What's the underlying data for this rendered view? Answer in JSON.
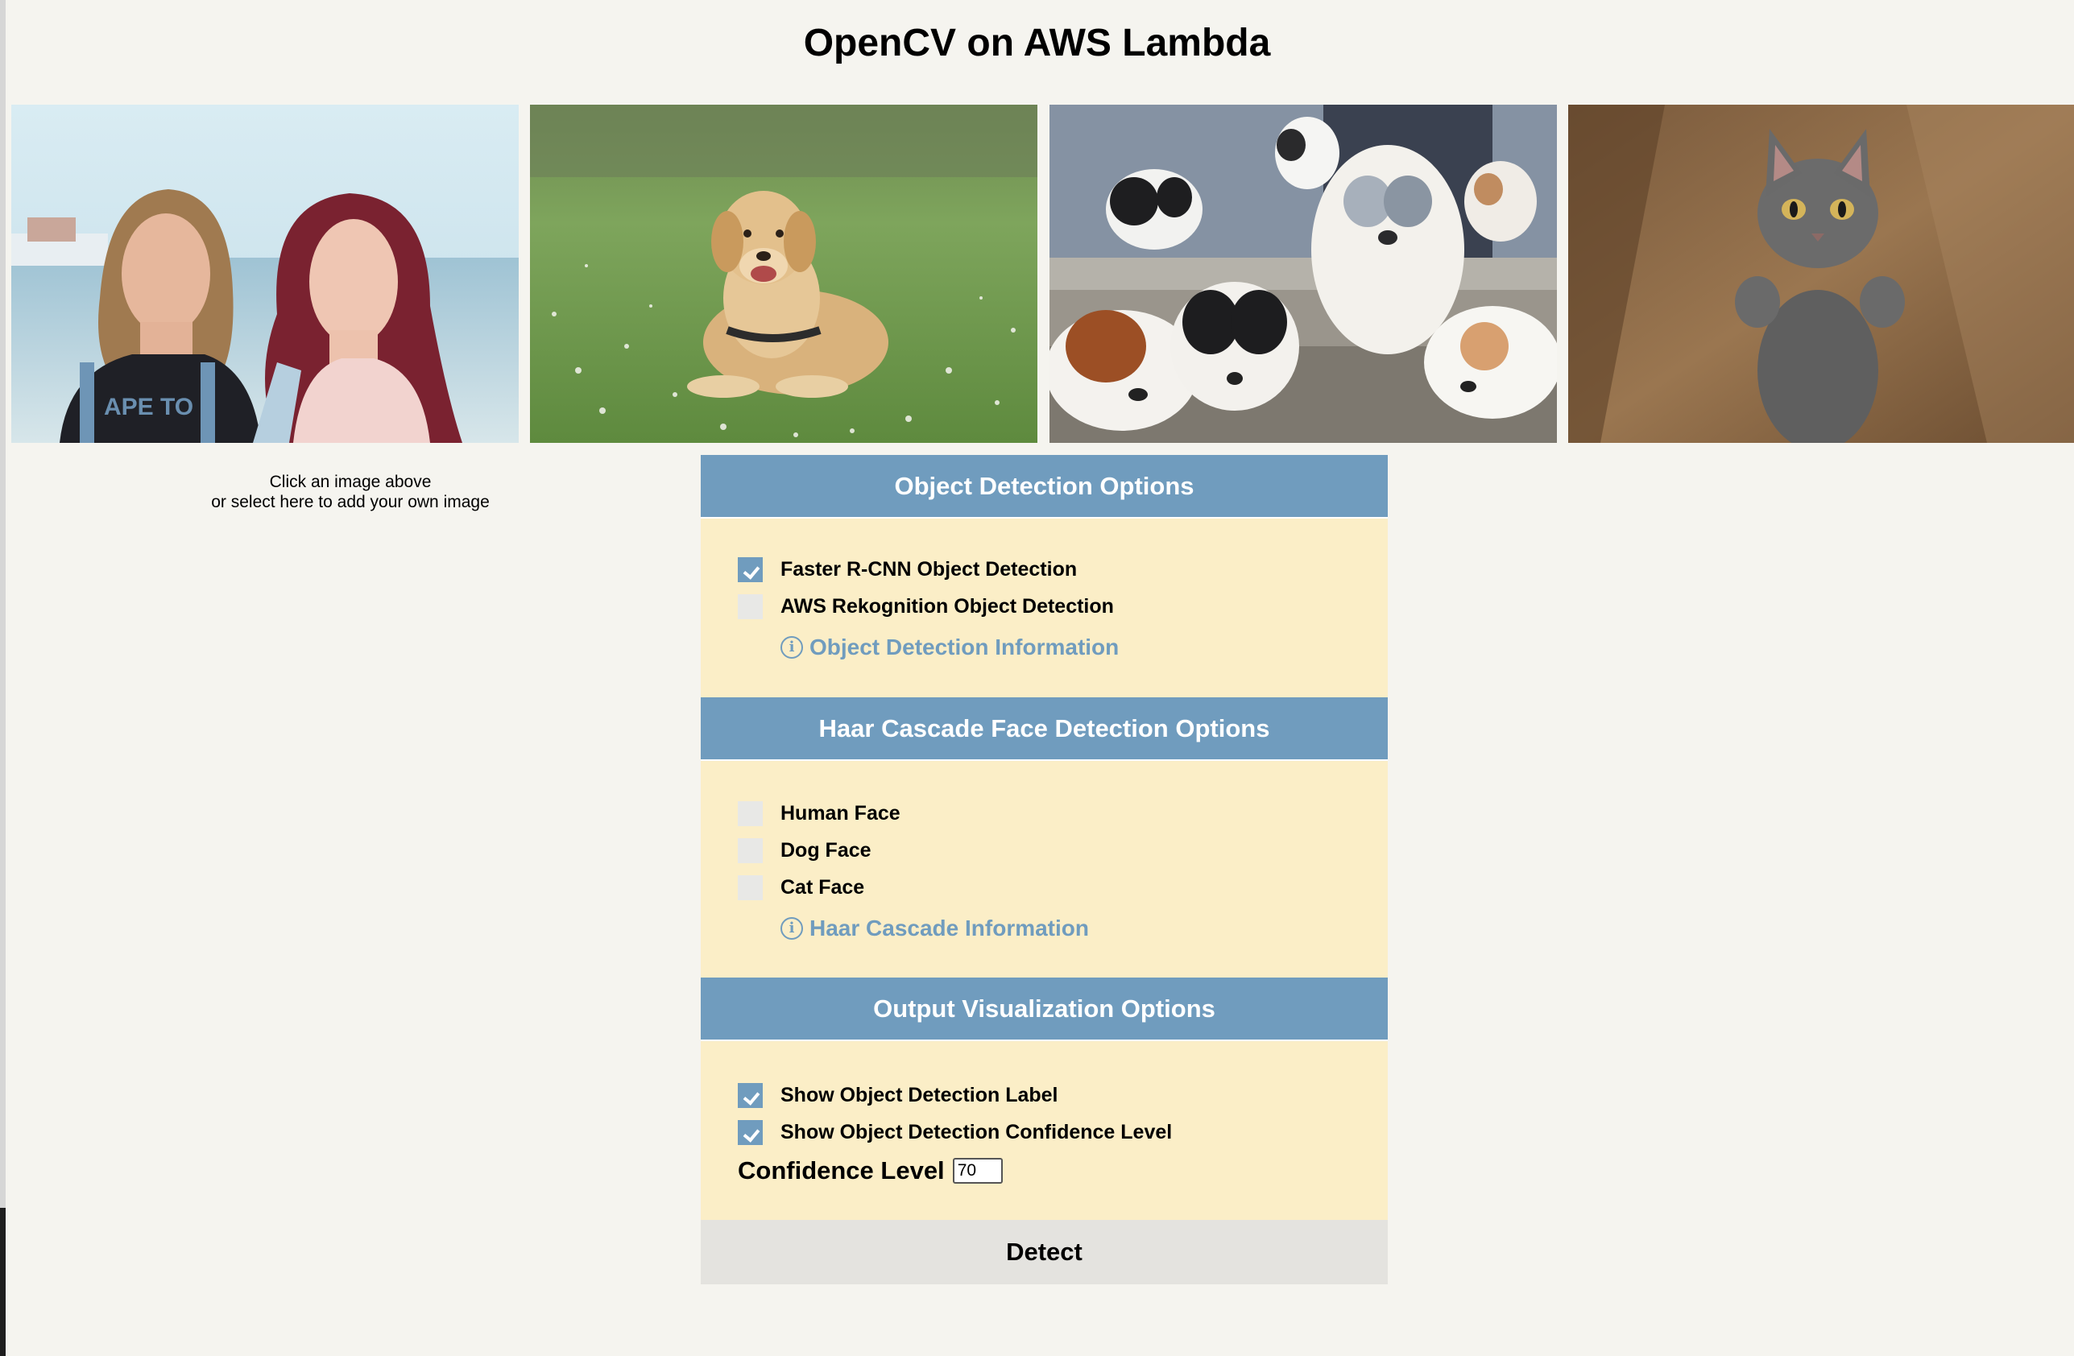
{
  "page": {
    "title": "OpenCV on AWS Lambda"
  },
  "gallery": {
    "images": [
      {
        "name": "two women at the beach",
        "shirt_text": "APE TO"
      },
      {
        "name": "golden retriever in grass"
      },
      {
        "name": "australian shepherd puppies"
      },
      {
        "name": "gray kitten standing"
      }
    ]
  },
  "upload_hint": {
    "line1": "Click an image above",
    "line2": "or select here to add your own image"
  },
  "object_detection": {
    "header": "Object Detection Options",
    "options": [
      {
        "label": "Faster R-CNN Object Detection",
        "checked": true
      },
      {
        "label": "AWS Rekognition Object Detection",
        "checked": false
      }
    ],
    "info_icon": "info-circle-icon",
    "info_symbol": "i",
    "info_label": "Object Detection Information"
  },
  "haar_cascade": {
    "header": "Haar Cascade Face Detection Options",
    "options": [
      {
        "label": "Human Face",
        "checked": false
      },
      {
        "label": "Dog Face",
        "checked": false
      },
      {
        "label": "Cat Face",
        "checked": false
      }
    ],
    "info_icon": "info-circle-icon",
    "info_symbol": "i",
    "info_label": "Haar Cascade Information"
  },
  "output_visualization": {
    "header": "Output Visualization Options",
    "options": [
      {
        "label": "Show Object Detection Label",
        "checked": true
      },
      {
        "label": "Show Object Detection Confidence Level",
        "checked": true
      }
    ],
    "confidence_label": "Confidence Level",
    "confidence_value": "70"
  },
  "detect_button": {
    "label": "Detect"
  },
  "colors": {
    "background": "#f5f4ef",
    "header": "#709cbe",
    "section_body": "#fbeec7",
    "detect_button": "#e4e3df",
    "checkbox_unchecked": "#e8e8e6"
  }
}
